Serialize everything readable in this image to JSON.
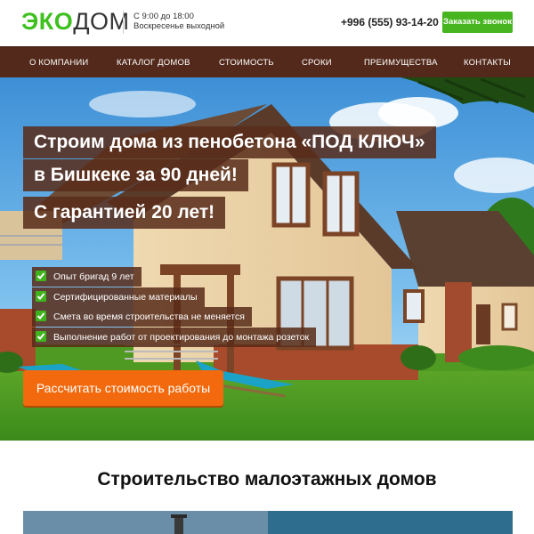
{
  "header": {
    "logo_eco": "ЭКО",
    "logo_dom": "ДОМ",
    "hours_line1": "С 9:00 до 18:00",
    "hours_line2": "Воскресенье выходной",
    "phone": "+996 (555) 93-14-20",
    "call_button": "Заказать звонок"
  },
  "nav": {
    "items": [
      {
        "label": "О КОМПАНИИ"
      },
      {
        "label": "КАТАЛОГ ДОМОВ"
      },
      {
        "label": "СТОИМОСТЬ"
      },
      {
        "label": "СРОКИ"
      },
      {
        "label": "ПРЕИМУЩЕСТВА"
      },
      {
        "label": "КОНТАКТЫ"
      }
    ]
  },
  "hero": {
    "headline": [
      "Строим дома из пенобетона «ПОД КЛЮЧ»",
      "в Бишкеке за 90 дней!",
      "С гарантией 20 лет!"
    ],
    "features": [
      "Опыт бригад 9 лет",
      "Сертифицированные материалы",
      "Смета во время строительства не меняется",
      "Выполнение работ от проектирования до монтажа розеток"
    ],
    "cta": "Рассчитать стоимость работы"
  },
  "section": {
    "title": "Строительство малоэтажных домов"
  },
  "colors": {
    "brand_green": "#3ec01f",
    "nav_brown": "#52291a",
    "cta_orange": "#f26a0d"
  }
}
